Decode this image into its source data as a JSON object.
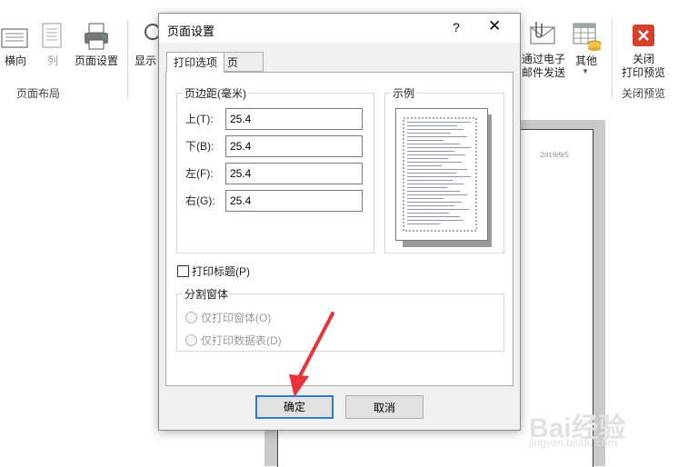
{
  "ribbon": {
    "orientation_label": "横向",
    "column_label": "列",
    "page_setup_label": "页面设置",
    "show_label": "显示",
    "group_page_layout": "页面布局",
    "email_label_line1": "通过电子",
    "email_label_line2": "邮件发送",
    "other_label": "其他",
    "close_label_line1": "关闭",
    "close_label_line2": "打印预览",
    "group_close_preview": "关闭预览"
  },
  "document": {
    "date_text": "2019/9/5"
  },
  "dialog": {
    "title": "页面设置",
    "help": "?",
    "close": "✕",
    "tabs": [
      {
        "label": "打印选项"
      },
      {
        "label": "页"
      }
    ],
    "margins": {
      "legend": "页边距(毫米)",
      "top_label": "上(T):",
      "top_value": "25.4",
      "bottom_label": "下(B):",
      "bottom_value": "25.4",
      "left_label": "左(F):",
      "left_value": "25.4",
      "right_label": "右(G):",
      "right_value": "25.4"
    },
    "preview": {
      "legend": "示例"
    },
    "print_titles": "打印标题(P)",
    "split_window": {
      "legend": "分割窗体",
      "option1": "仅打印窗体(O)",
      "option2": "仅打印数据表(D)"
    },
    "ok": "确定",
    "cancel": "取消"
  },
  "watermark": {
    "brand": "Bai经验",
    "url": "jingyan.baidu.com"
  },
  "colors": {
    "arrow": "#e8333b",
    "close_icon_bg": "#d7412b",
    "default_button_border": "#2e7cd6"
  }
}
